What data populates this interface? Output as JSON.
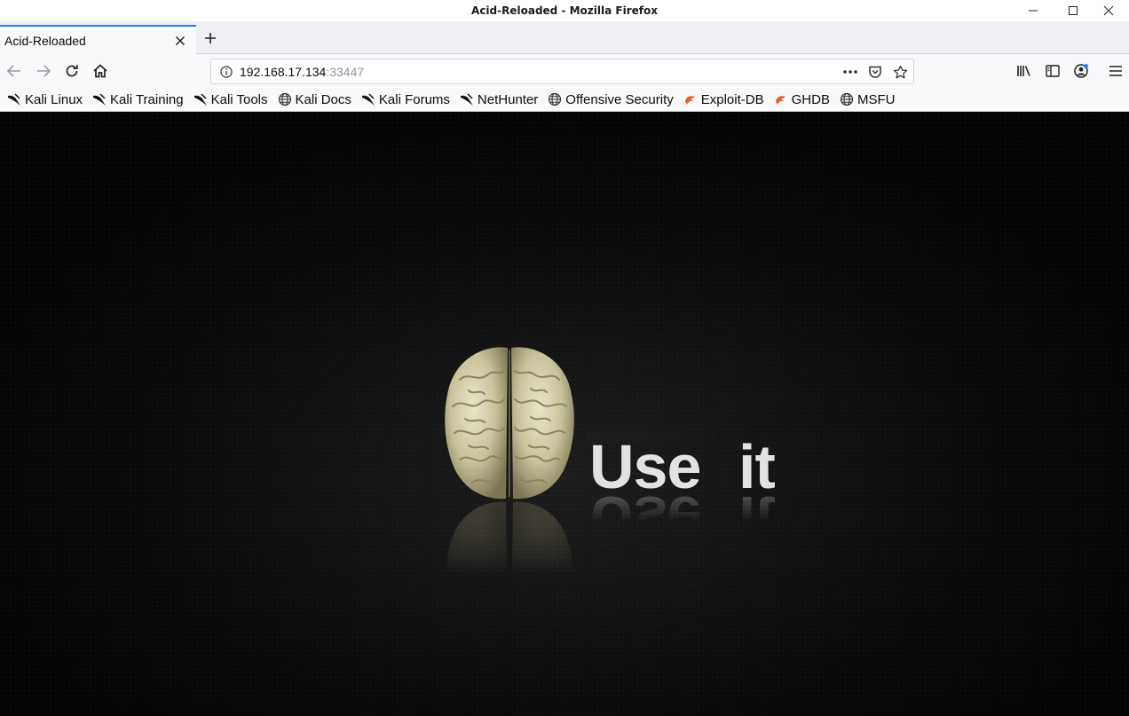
{
  "window": {
    "title": "Acid-Reloaded - Mozilla Firefox"
  },
  "tab": {
    "title": "Acid-Reloaded"
  },
  "urlbar": {
    "host": "192.168.17.134",
    "port": ":33447"
  },
  "bookmarks": [
    {
      "label": "Kali Linux",
      "icon": "kali-dragon-icon"
    },
    {
      "label": "Kali Training",
      "icon": "kali-dragon-icon"
    },
    {
      "label": "Kali Tools",
      "icon": "kali-dragon-icon"
    },
    {
      "label": "Kali Docs",
      "icon": "globe-icon"
    },
    {
      "label": "Kali Forums",
      "icon": "kali-dragon-icon"
    },
    {
      "label": "NetHunter",
      "icon": "kali-dragon-icon"
    },
    {
      "label": "Offensive Security",
      "icon": "globe-icon"
    },
    {
      "label": "Exploit-DB",
      "icon": "exploit-db-icon"
    },
    {
      "label": "GHDB",
      "icon": "exploit-db-icon"
    },
    {
      "label": "MSFU",
      "icon": "globe-icon"
    }
  ],
  "page": {
    "hero_left": "Use",
    "hero_right": "it"
  },
  "colors": {
    "accent": "#0a84ff",
    "page_background": "#0b0b0b",
    "hero_text": "#e2e2e2",
    "exploit_db_orange": "#e8602c"
  }
}
